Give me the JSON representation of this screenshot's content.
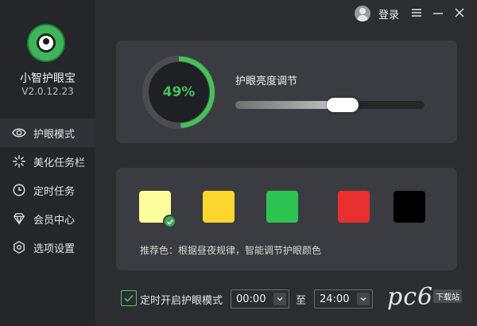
{
  "app": {
    "name": "小智护眼宝",
    "version": "V2.0.12.23",
    "logo_icon": "eye-logo-icon"
  },
  "topbar": {
    "login_label": "登录"
  },
  "sidebar": {
    "items": [
      {
        "label": "护眼模式",
        "icon": "eye-icon",
        "active": true
      },
      {
        "label": "美化任务栏",
        "icon": "sparkle-icon",
        "active": false
      },
      {
        "label": "定时任务",
        "icon": "clock-icon",
        "active": false
      },
      {
        "label": "会员中心",
        "icon": "diamond-icon",
        "active": false
      },
      {
        "label": "选项设置",
        "icon": "settings-icon",
        "active": false
      }
    ]
  },
  "brightness": {
    "percent_label": "49%",
    "percent": 49,
    "label": "护眼亮度调节",
    "slider_value": 0.58
  },
  "colors": {
    "swatches": [
      {
        "color": "#fdfe9b",
        "selected": true
      },
      {
        "color": "#fdd62e",
        "selected": false
      },
      {
        "color": "#2dc451",
        "selected": false
      },
      {
        "color": "#ea2f2f",
        "selected": false
      },
      {
        "color": "#000000",
        "selected": false
      }
    ],
    "recommend_text": "推荐色：根据昼夜规律，智能调节护眼颜色"
  },
  "schedule": {
    "checkbox_label": "定时开启护眼模式",
    "checked": true,
    "start": "00:00",
    "to_label": "至",
    "end": "24:00"
  },
  "watermark": {
    "text": "pc6",
    "badge": "下载站"
  },
  "theme": {
    "accent": "#45c15a",
    "bg": "#2b2d31",
    "panel": "#3a3c41"
  }
}
